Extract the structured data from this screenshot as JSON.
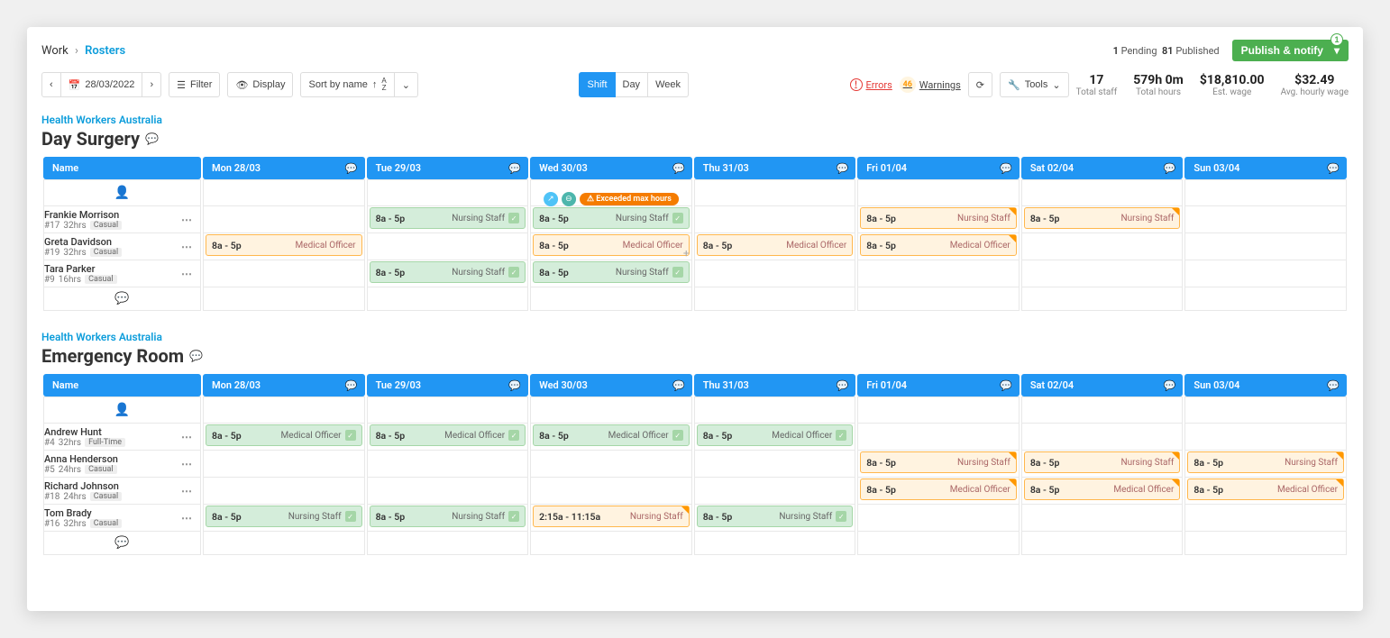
{
  "breadcrumb": {
    "parent": "Work",
    "current": "Rosters"
  },
  "publish": {
    "pending_count": "1",
    "pending_label": "Pending",
    "published_count": "81",
    "published_label": "Published",
    "button": "Publish & notify",
    "badge": "1"
  },
  "toolbar": {
    "date": "28/03/2022",
    "filter": "Filter",
    "display": "Display",
    "sort": "Sort by name",
    "view_shift": "Shift",
    "view_day": "Day",
    "view_week": "Week",
    "errors": "Errors",
    "warnings": "Warnings",
    "warnings_count": "46",
    "tools": "Tools"
  },
  "stats": {
    "staff_val": "17",
    "staff_lbl": "Total staff",
    "hours_val": "579h 0m",
    "hours_lbl": "Total hours",
    "wage_val": "$18,810.00",
    "wage_lbl": "Est. wage",
    "avg_val": "$32.49",
    "avg_lbl": "Avg. hourly wage"
  },
  "days": [
    "Mon 28/03",
    "Tue 29/03",
    "Wed 30/03",
    "Thu 31/03",
    "Fri 01/04",
    "Sat 02/04",
    "Sun 03/04"
  ],
  "name_header": "Name",
  "warn_msg": "Exceeded max hours",
  "sections": [
    {
      "org": "Health Workers Australia",
      "location": "Day Surgery",
      "employees": [
        {
          "name": "Frankie Morrison",
          "id": "#17",
          "hours": "32hrs",
          "type": "Casual",
          "shifts": [
            null,
            {
              "time": "8a - 5p",
              "role": "Nursing Staff",
              "style": "green",
              "tick": true
            },
            {
              "time": "8a - 5p",
              "role": "Nursing Staff",
              "style": "green",
              "tick": true,
              "warn": true
            },
            null,
            {
              "time": "8a - 5p",
              "role": "Nursing Staff",
              "style": "orange",
              "corner": true
            },
            {
              "time": "8a - 5p",
              "role": "Nursing Staff",
              "style": "orange",
              "corner": true
            },
            null
          ]
        },
        {
          "name": "Greta Davidson",
          "id": "#19",
          "hours": "32hrs",
          "type": "Casual",
          "shifts": [
            {
              "time": "8a - 5p",
              "role": "Medical Officer",
              "style": "orange"
            },
            null,
            {
              "time": "8a - 5p",
              "role": "Medical Officer",
              "style": "orange",
              "add": true
            },
            {
              "time": "8a - 5p",
              "role": "Medical Officer",
              "style": "orange"
            },
            {
              "time": "8a - 5p",
              "role": "Medical Officer",
              "style": "orange",
              "corner": true
            },
            null,
            null
          ]
        },
        {
          "name": "Tara Parker",
          "id": "#9",
          "hours": "16hrs",
          "type": "Casual",
          "shifts": [
            null,
            {
              "time": "8a - 5p",
              "role": "Nursing Staff",
              "style": "green",
              "tick": true
            },
            {
              "time": "8a - 5p",
              "role": "Nursing Staff",
              "style": "green",
              "tick": true
            },
            null,
            null,
            null,
            null
          ]
        }
      ]
    },
    {
      "org": "Health Workers Australia",
      "location": "Emergency Room",
      "employees": [
        {
          "name": "Andrew Hunt",
          "id": "#4",
          "hours": "32hrs",
          "type": "Full-Time",
          "shifts": [
            {
              "time": "8a - 5p",
              "role": "Medical Officer",
              "style": "green",
              "tick": true
            },
            {
              "time": "8a - 5p",
              "role": "Medical Officer",
              "style": "green",
              "tick": true
            },
            {
              "time": "8a - 5p",
              "role": "Medical Officer",
              "style": "green",
              "tick": true
            },
            {
              "time": "8a - 5p",
              "role": "Medical Officer",
              "style": "green",
              "tick": true
            },
            null,
            null,
            null
          ]
        },
        {
          "name": "Anna Henderson",
          "id": "#5",
          "hours": "24hrs",
          "type": "Casual",
          "shifts": [
            null,
            null,
            null,
            null,
            {
              "time": "8a - 5p",
              "role": "Nursing Staff",
              "style": "orange",
              "corner": true
            },
            {
              "time": "8a - 5p",
              "role": "Nursing Staff",
              "style": "orange",
              "corner": true
            },
            {
              "time": "8a - 5p",
              "role": "Nursing Staff",
              "style": "orange",
              "corner": true
            }
          ]
        },
        {
          "name": "Richard Johnson",
          "id": "#18",
          "hours": "24hrs",
          "type": "Casual",
          "shifts": [
            null,
            null,
            null,
            null,
            {
              "time": "8a - 5p",
              "role": "Medical Officer",
              "style": "orange",
              "corner": true
            },
            {
              "time": "8a - 5p",
              "role": "Medical Officer",
              "style": "orange",
              "corner": true
            },
            {
              "time": "8a - 5p",
              "role": "Medical Officer",
              "style": "orange",
              "corner": true
            }
          ]
        },
        {
          "name": "Tom Brady",
          "id": "#16",
          "hours": "32hrs",
          "type": "Casual",
          "shifts": [
            {
              "time": "8a - 5p",
              "role": "Nursing Staff",
              "style": "green",
              "tick": true
            },
            {
              "time": "8a - 5p",
              "role": "Nursing Staff",
              "style": "green",
              "tick": true
            },
            {
              "time": "2:15a - 11:15a",
              "role": "Nursing Staff",
              "style": "orange",
              "corner": true
            },
            {
              "time": "8a - 5p",
              "role": "Nursing Staff",
              "style": "green",
              "tick": true
            },
            null,
            null,
            null
          ]
        }
      ]
    }
  ]
}
